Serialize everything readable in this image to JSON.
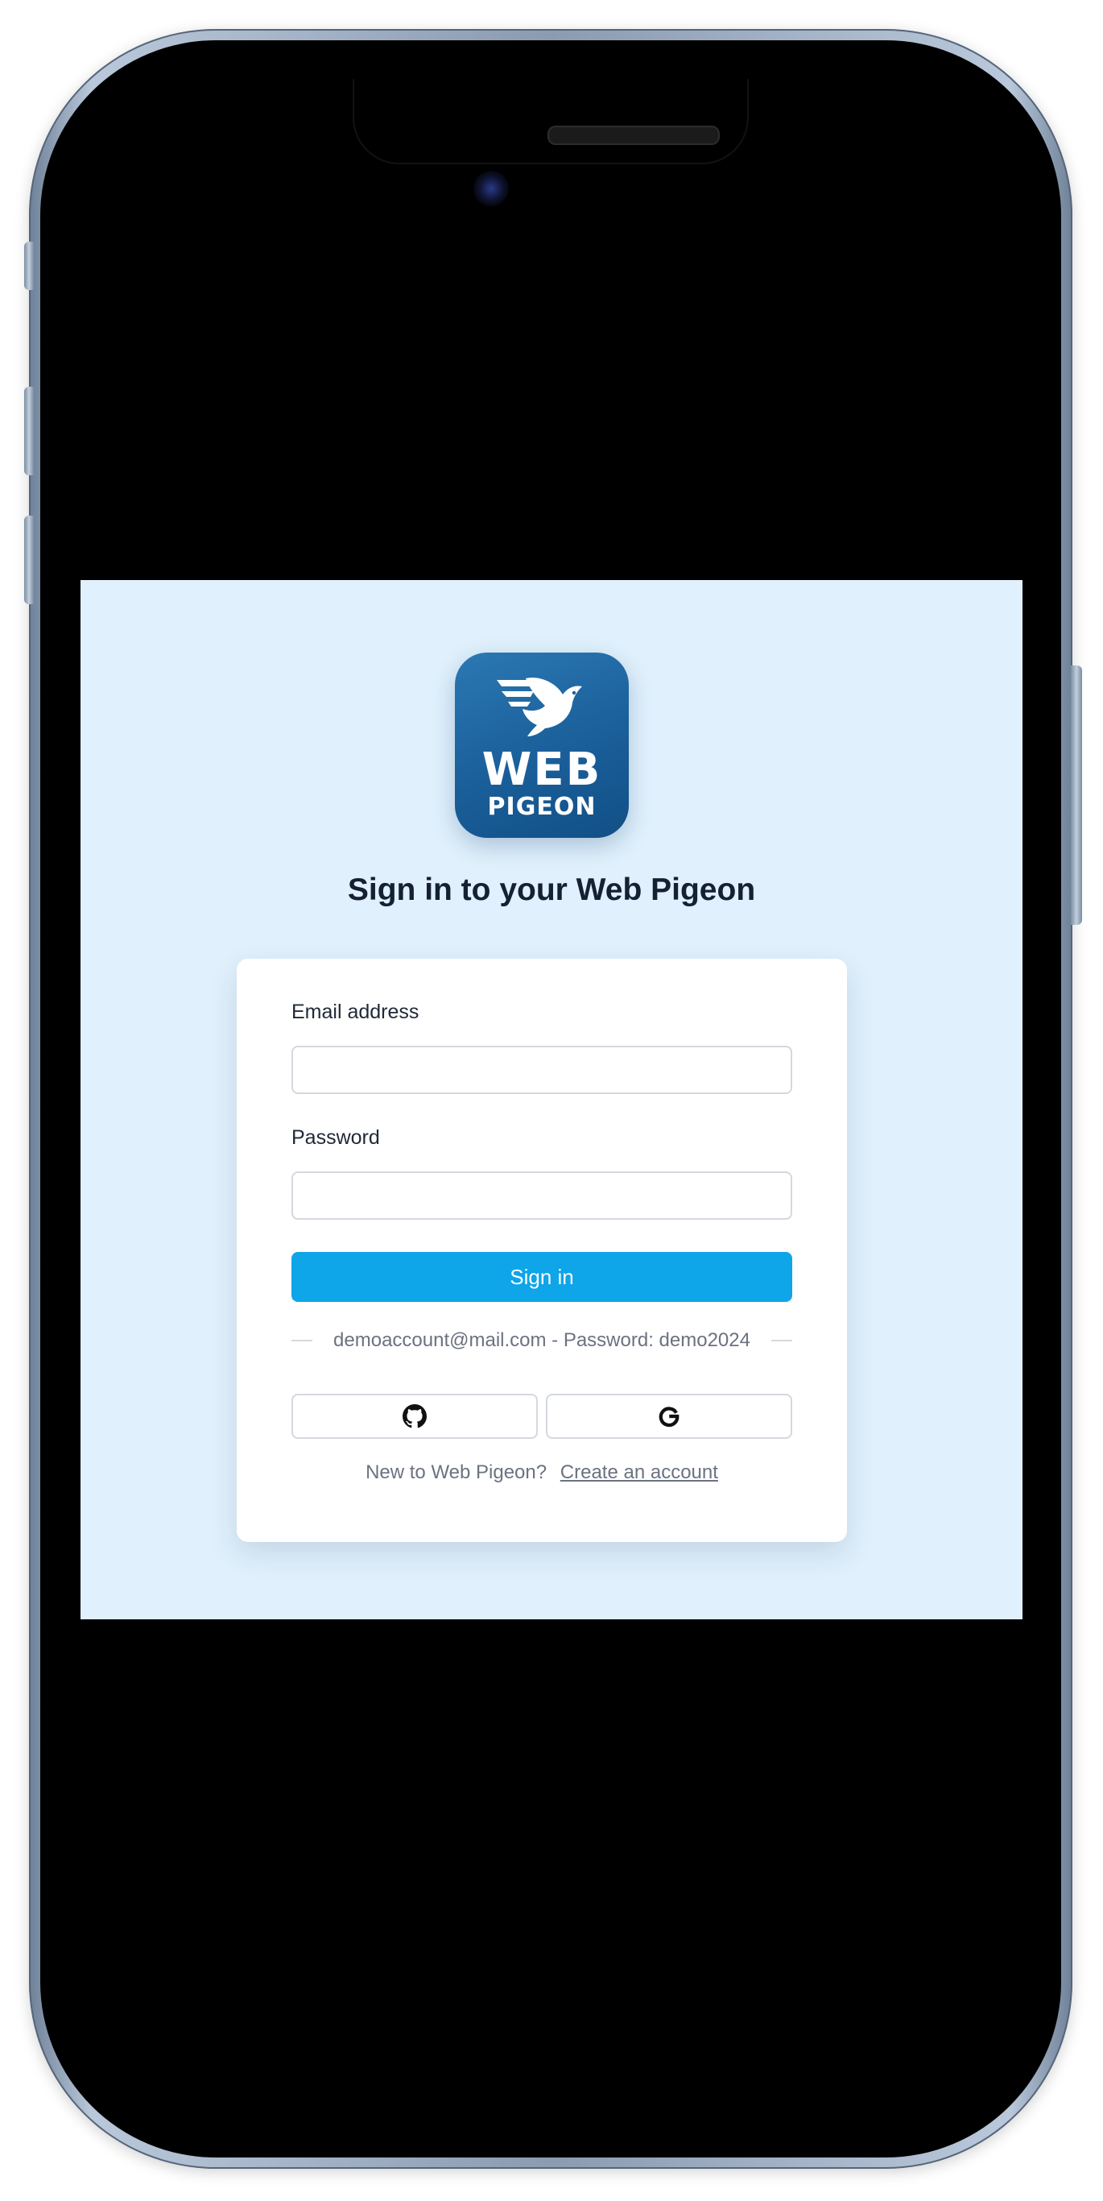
{
  "logo": {
    "line1": "WEB",
    "line2": "PIGEON",
    "icon": "pigeon-icon"
  },
  "page": {
    "title": "Sign in to your Web Pigeon"
  },
  "form": {
    "email_label": "Email address",
    "email_value": "",
    "password_label": "Password",
    "password_value": "",
    "submit_label": "Sign in"
  },
  "divider": {
    "text": "demoaccount@mail.com - Password: demo2024"
  },
  "social": {
    "github_icon": "github-icon",
    "google_icon": "google-icon"
  },
  "signup": {
    "prompt": "New to Web Pigeon?",
    "link_label": "Create an account"
  },
  "colors": {
    "page_background": "#e0f0fc",
    "primary": "#0ea5e9",
    "logo_blue": "#1a5f9a",
    "title_text": "#152033"
  }
}
